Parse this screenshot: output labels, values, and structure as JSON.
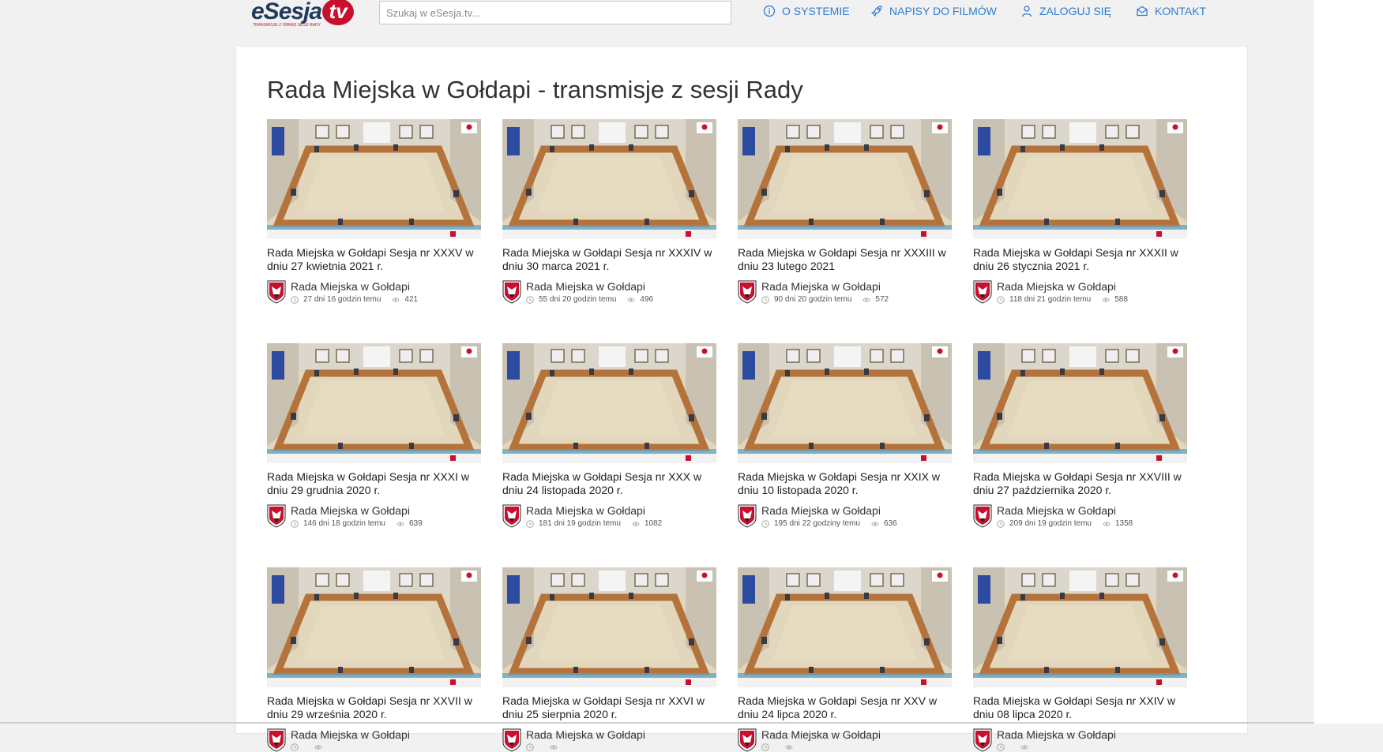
{
  "header": {
    "logo_text": "eSesja",
    "logo_tv": "tv",
    "logo_sub": "TRANSMISJE Z OBRAD SESJI RADY",
    "search_placeholder": "Szukaj w eSesja.tv...",
    "nav": [
      {
        "label": "O SYSTEMIE",
        "icon": "info-icon"
      },
      {
        "label": "NAPISY DO FILMÓW",
        "icon": "rocket-icon"
      },
      {
        "label": "ZALOGUJ SIĘ",
        "icon": "user-icon"
      },
      {
        "label": "KONTAKT",
        "icon": "envelope-icon"
      }
    ]
  },
  "main": {
    "title": "Rada Miejska w Gołdapi - transmisje z sesji Rady",
    "videos": [
      {
        "title": "Rada Miejska w Gołdapi Sesja nr XXXV w dniu 27 kwietnia 2021 r.",
        "channel": "Rada Miejska w Gołdapi",
        "age": "27 dni 16 godzin temu",
        "views": "421"
      },
      {
        "title": "Rada Miejska w Gołdapi Sesja nr XXXIV w dniu 30 marca 2021 r.",
        "channel": "Rada Miejska w Gołdapi",
        "age": "55 dni 20 godzin temu",
        "views": "496"
      },
      {
        "title": "Rada Miejska w Gołdapi Sesja nr XXXIII w dniu 23 lutego 2021",
        "channel": "Rada Miejska w Gołdapi",
        "age": "90 dni 20 godzin temu",
        "views": "572"
      },
      {
        "title": "Rada Miejska w Gołdapi Sesja nr XXXII w dniu 26 stycznia 2021 r.",
        "channel": "Rada Miejska w Gołdapi",
        "age": "118 dni 21 godzin temu",
        "views": "588"
      },
      {
        "title": "Rada Miejska w Gołdapi Sesja nr XXXI w dniu 29 grudnia 2020 r.",
        "channel": "Rada Miejska w Gołdapi",
        "age": "146 dni 18 godzin temu",
        "views": "639"
      },
      {
        "title": "Rada Miejska w Gołdapi Sesja nr XXX w dniu 24 listopada 2020 r.",
        "channel": "Rada Miejska w Gołdapi",
        "age": "181 dni 19 godzin temu",
        "views": "1082"
      },
      {
        "title": "Rada Miejska w Gołdapi Sesja nr XXIX w dniu 10 listopada 2020 r.",
        "channel": "Rada Miejska w Gołdapi",
        "age": "195 dni 22 godziny temu",
        "views": "636"
      },
      {
        "title": "Rada Miejska w Gołdapi Sesja nr XXVIII w dniu 27 października 2020 r.",
        "channel": "Rada Miejska w Gołdapi",
        "age": "209 dni 19 godzin temu",
        "views": "1358"
      },
      {
        "title": "Rada Miejska w Gołdapi Sesja nr XXVII w dniu 29 września 2020 r.",
        "channel": "Rada Miejska w Gołdapi",
        "age": "",
        "views": ""
      },
      {
        "title": "Rada Miejska w Gołdapi Sesja nr XXVI w dniu 25 sierpnia 2020 r.",
        "channel": "Rada Miejska w Gołdapi",
        "age": "",
        "views": ""
      },
      {
        "title": "Rada Miejska w Gołdapi Sesja nr XXV w dniu 24 lipca 2020 r.",
        "channel": "Rada Miejska w Gołdapi",
        "age": "",
        "views": ""
      },
      {
        "title": "Rada Miejska w Gołdapi Sesja nr XXIV w dniu 08 lipca 2020 r.",
        "channel": "Rada Miejska w Gołdapi",
        "age": "",
        "views": ""
      }
    ]
  },
  "colors": {
    "accent": "#2e7dd1",
    "brand_red": "#c8102e",
    "table_wood": "#b5733c",
    "floor": "#e2d7bc"
  }
}
